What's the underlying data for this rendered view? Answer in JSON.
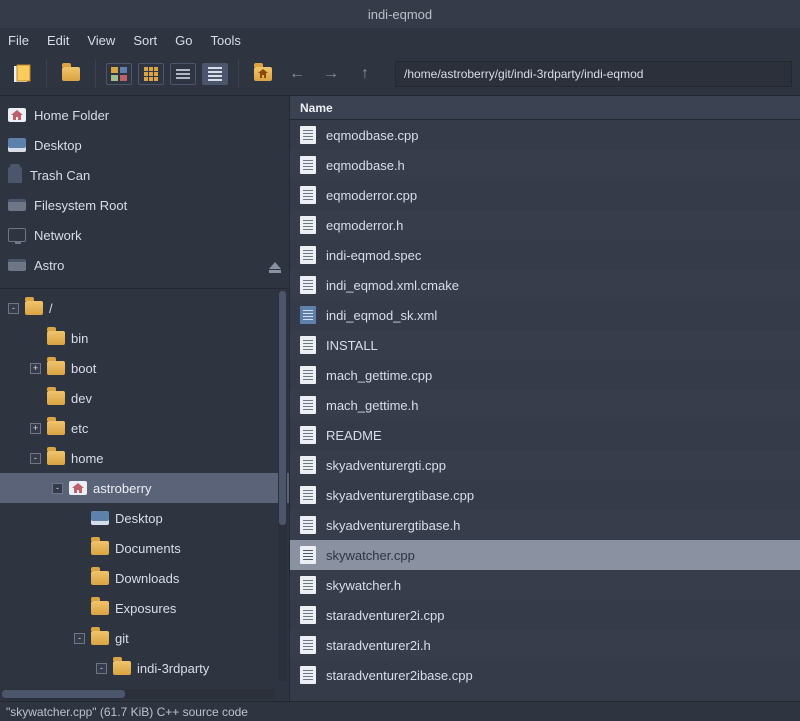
{
  "title": "indi-eqmod",
  "menu": [
    "File",
    "Edit",
    "View",
    "Sort",
    "Go",
    "Tools"
  ],
  "path": "/home/astroberry/git/indi-3rdparty/indi-eqmod",
  "places": [
    {
      "id": "home",
      "label": "Home Folder",
      "icon": "home"
    },
    {
      "id": "desktop",
      "label": "Desktop",
      "icon": "desktop"
    },
    {
      "id": "trash",
      "label": "Trash Can",
      "icon": "trash"
    },
    {
      "id": "fsroot",
      "label": "Filesystem Root",
      "icon": "drive"
    },
    {
      "id": "network",
      "label": "Network",
      "icon": "net"
    },
    {
      "id": "astro",
      "label": "Astro",
      "icon": "drive",
      "eject": true
    }
  ],
  "tree": [
    {
      "indent": 0,
      "exp": "-",
      "label": "/",
      "icon": "folder"
    },
    {
      "indent": 1,
      "exp": "",
      "label": "bin",
      "icon": "folder"
    },
    {
      "indent": 1,
      "exp": "+",
      "label": "boot",
      "icon": "folder"
    },
    {
      "indent": 1,
      "exp": "",
      "label": "dev",
      "icon": "folder"
    },
    {
      "indent": 1,
      "exp": "+",
      "label": "etc",
      "icon": "folder"
    },
    {
      "indent": 1,
      "exp": "-",
      "label": "home",
      "icon": "folder"
    },
    {
      "indent": 2,
      "exp": "-",
      "label": "astroberry",
      "icon": "home",
      "selected": true
    },
    {
      "indent": 3,
      "exp": "",
      "label": "Desktop",
      "icon": "desktop"
    },
    {
      "indent": 3,
      "exp": "",
      "label": "Documents",
      "icon": "folder"
    },
    {
      "indent": 3,
      "exp": "",
      "label": "Downloads",
      "icon": "folder"
    },
    {
      "indent": 3,
      "exp": "",
      "label": "Exposures",
      "icon": "folder"
    },
    {
      "indent": 3,
      "exp": "-",
      "label": "git",
      "icon": "folder"
    },
    {
      "indent": 4,
      "exp": "-",
      "label": "indi-3rdparty",
      "icon": "folder"
    }
  ],
  "column_header": "Name",
  "files": [
    {
      "name": "eqmodbase.cpp",
      "type": "doc"
    },
    {
      "name": "eqmodbase.h",
      "type": "doc"
    },
    {
      "name": "eqmoderror.cpp",
      "type": "doc"
    },
    {
      "name": "eqmoderror.h",
      "type": "doc"
    },
    {
      "name": "indi-eqmod.spec",
      "type": "doc"
    },
    {
      "name": "indi_eqmod.xml.cmake",
      "type": "doc"
    },
    {
      "name": "indi_eqmod_sk.xml",
      "type": "xml"
    },
    {
      "name": "INSTALL",
      "type": "doc"
    },
    {
      "name": "mach_gettime.cpp",
      "type": "doc"
    },
    {
      "name": "mach_gettime.h",
      "type": "doc"
    },
    {
      "name": "README",
      "type": "doc"
    },
    {
      "name": "skyadventurergti.cpp",
      "type": "doc"
    },
    {
      "name": "skyadventurergtibase.cpp",
      "type": "doc"
    },
    {
      "name": "skyadventurergtibase.h",
      "type": "doc"
    },
    {
      "name": "skywatcher.cpp",
      "type": "doc",
      "selected": true
    },
    {
      "name": "skywatcher.h",
      "type": "doc"
    },
    {
      "name": "staradventurer2i.cpp",
      "type": "doc"
    },
    {
      "name": "staradventurer2i.h",
      "type": "doc"
    },
    {
      "name": "staradventurer2ibase.cpp",
      "type": "doc"
    }
  ],
  "status": "\"skywatcher.cpp\" (61.7 KiB) C++ source code"
}
